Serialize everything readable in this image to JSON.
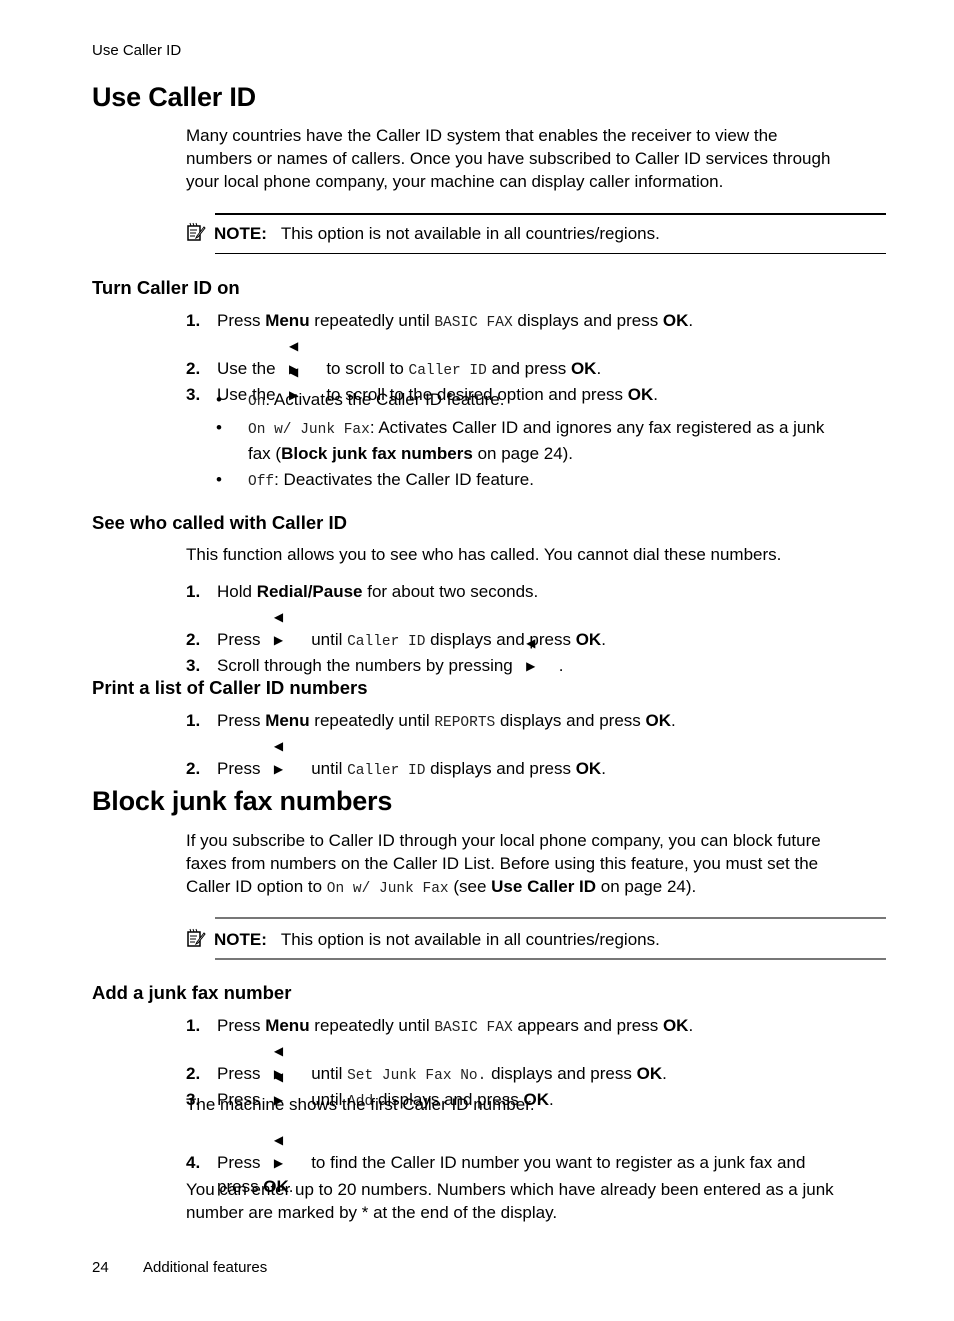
{
  "running_header": "Use Caller ID",
  "section1": {
    "title": "Use Caller ID",
    "intro": [
      "Many countries have the Caller ID system that enables the receiver to view the",
      "numbers or names of callers. Once you have subscribed to Caller ID services through",
      "your local phone company, your machine can display caller information."
    ],
    "note": {
      "label": "NOTE:",
      "text": "This option is not available in all countries/regions."
    },
    "turn_on": {
      "title": "Turn Caller ID on",
      "steps": [
        {
          "num": "1.",
          "a": "Press ",
          "b": "Menu",
          "c": " repeatedly until ",
          "mono": "BASIC FAX",
          "d": " displays and press ",
          "e": "OK",
          "f": "."
        },
        {
          "num": "2.",
          "a": "Use the",
          "arrows": "◀ ▶",
          "c": " to scroll to ",
          "mono": "Caller ID",
          "d": " and press ",
          "e": "OK",
          "f": "."
        },
        {
          "num": "3.",
          "a": "Use the",
          "arrows": "◀ ▶",
          "c": " to scroll to the desired option and press ",
          "e": "OK",
          "f": "."
        }
      ],
      "options": [
        {
          "mono": "On",
          "text": ": Activates the Caller ID feature."
        },
        {
          "mono": "On w/ Junk Fax",
          "text": ": Activates Caller ID and ignores any fax registered as a junk",
          "text2a": "fax (",
          "link": "Block junk fax numbers",
          "text2b": " on page 24)."
        },
        {
          "mono": "Off",
          "text": ": Deactivates the Caller ID feature."
        }
      ]
    },
    "see_who": {
      "title": "See who called with Caller ID",
      "intro": "This function allows you to see who has called. You cannot dial these numbers.",
      "steps": [
        {
          "num": "1.",
          "a": "Hold ",
          "b": "Redial/Pause",
          "c": " for about two seconds."
        },
        {
          "num": "2.",
          "a": "Press",
          "arrows": "◀ ▶",
          "c": " until ",
          "mono": "Caller ID",
          "d": " displays and press ",
          "e": "OK",
          "f": "."
        },
        {
          "num": "3.",
          "a": "Scroll through the numbers by pressing",
          "arrows": "◀ ▶",
          "f": "."
        }
      ]
    },
    "print_list": {
      "title": "Print a list of Caller ID numbers",
      "steps": [
        {
          "num": "1.",
          "a": "Press ",
          "b": "Menu",
          "c": " repeatedly until ",
          "mono": "REPORTS",
          "d": " displays and press ",
          "e": "OK",
          "f": "."
        },
        {
          "num": "2.",
          "a": "Press",
          "arrows": "◀ ▶",
          "c": " until ",
          "mono": "Caller ID",
          "d": " displays and press ",
          "e": "OK",
          "f": "."
        }
      ]
    }
  },
  "section2": {
    "title": "Block junk fax numbers",
    "intro1": "If you subscribe to Caller ID through your local phone company, you can block future",
    "intro2": "faxes from numbers on the Caller ID List. Before using this feature, you must set the",
    "intro3a": "Caller ID option to ",
    "intro3_mono": "On w/ Junk Fax",
    "intro3b": " (see ",
    "intro3_link": "Use Caller ID",
    "intro3c": " on page 24).",
    "note": {
      "label": "NOTE:",
      "text": "This option is not available in all countries/regions."
    },
    "add": {
      "title": "Add a junk fax number",
      "steps": [
        {
          "num": "1.",
          "a": "Press ",
          "b": "Menu",
          "c": " repeatedly until ",
          "mono": "BASIC FAX",
          "d": " appears and press ",
          "e": "OK",
          "f": "."
        },
        {
          "num": "2.",
          "a": "Press",
          "arrows": "◀ ▶",
          "c": " until ",
          "mono": "Set Junk Fax No.",
          "d": " displays and press ",
          "e": "OK",
          "f": "."
        },
        {
          "num": "3.",
          "a": "Press",
          "arrows": "◀ ▶",
          "c": " until ",
          "mono": "Add",
          "d": " displays and press ",
          "e": "OK",
          "f": "."
        },
        {
          "num": "4.",
          "a": "Press",
          "arrows": "◀ ▶",
          "c": " to find the Caller ID number you want to register as a junk fax and",
          "c2": "press ",
          "e": "OK",
          "f": "."
        }
      ],
      "after3": "The machine shows the first Caller ID number.",
      "after4": [
        "You can enter up to 20 numbers. Numbers which have already been entered as a junk",
        "number are marked by * at the end of the display."
      ]
    }
  },
  "footer": {
    "page": "24",
    "title": "Additional features"
  }
}
